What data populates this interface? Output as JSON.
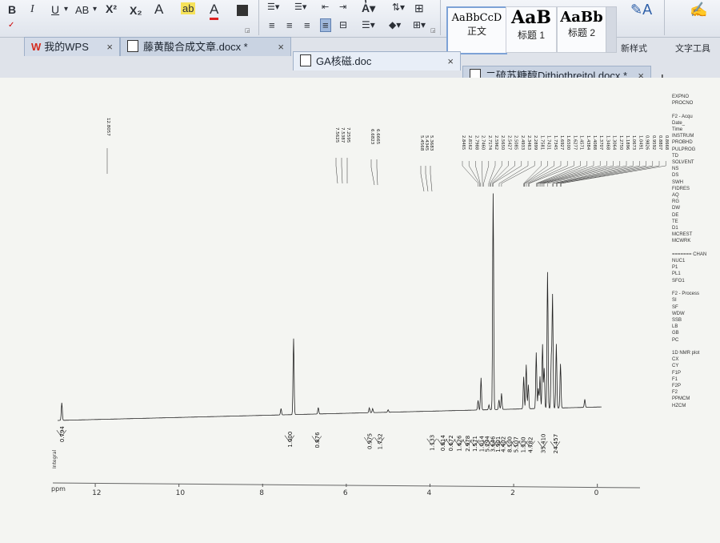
{
  "toolbar": {
    "bold": "B",
    "italic": "I",
    "underline": "U",
    "font_case": "AB",
    "superscript": "X²",
    "subscript": "X₂",
    "text_effect": "A",
    "highlight": "ab",
    "font_color": "A",
    "styles": [
      {
        "preview": "AaBbCcD",
        "name": "正文"
      },
      {
        "preview": "AaB",
        "name": "标题 1"
      },
      {
        "preview": "AaBb",
        "name": "标题 2"
      }
    ],
    "new_style": "新样式",
    "text_tools": "文字工具"
  },
  "tabs": [
    {
      "label": "我的WPS",
      "close": "×"
    },
    {
      "label": "藤黄酸合成文章.docx *",
      "close": "×"
    },
    {
      "label": "GA核磁.doc",
      "close": "×"
    },
    {
      "label": "二硫苏糖醇Dithiothreitol.docx *",
      "close": "×"
    }
  ],
  "new_tab": "+",
  "spectrum": {
    "ppm_axis_label": "ppm",
    "integral_label": "Integral",
    "axis_ticks": [
      "12",
      "10",
      "8",
      "6",
      "4",
      "2",
      "0"
    ],
    "peak_labels_group1": [
      "12.8057"
    ],
    "peak_labels_group2": [
      "7.5625",
      "7.5387",
      "7.2595"
    ],
    "peak_labels_group3": [
      "6.6823",
      "6.6665"
    ],
    "peak_labels_group4": [
      "5.4568",
      "5.4345",
      "5.3683"
    ],
    "peak_labels_group5": [
      "2.8465",
      "2.8162",
      "2.7988",
      "2.7460",
      "2.7174",
      "2.5962",
      "2.5650",
      "2.5427",
      "2.5085",
      "2.4933",
      "2.3463",
      "2.2899",
      "1.7581",
      "1.7431",
      "1.7345",
      "1.6927",
      "1.6500",
      "1.6277",
      "1.4571",
      "1.4384",
      "1.4088",
      "1.3707",
      "1.3468",
      "1.3064",
      "1.2750",
      "1.1896",
      "1.0673",
      "1.0491",
      "0.9826",
      "0.9592",
      "0.8807",
      "0.8668"
    ],
    "integrals": [
      "0.794",
      "1.000",
      "0.876",
      "0.975",
      "1.732",
      "1.133",
      "0.814",
      "0.672",
      "1.626",
      "2.978",
      "1.571",
      "1.014",
      "5.294",
      "3.646",
      "1.901",
      "4.402",
      "8.100",
      "5.107",
      "1.330",
      "4.782",
      "35.410",
      "24.457"
    ],
    "side_params": [
      "EXPNO",
      "PROCNO",
      "",
      "F2 - Acqu",
      "Date_",
      "Time",
      "INSTRUM",
      "PROBHD",
      "PULPROG",
      "TD",
      "SOLVENT",
      "NS",
      "DS",
      "SWH",
      "FIDRES",
      "AQ",
      "RG",
      "DW",
      "DE",
      "TE",
      "D1",
      "MCREST",
      "MCWRK",
      "",
      "======= CHAN",
      "NUC1",
      "P1",
      "PL1",
      "SFO1",
      "",
      "F2 - Process",
      "SI",
      "SF",
      "WDW",
      "SSB",
      "LB",
      "GB",
      "PC",
      "",
      "1D NMR plot",
      "CX",
      "CY",
      "F1P",
      "F1",
      "F2P",
      "F2",
      "PPMCM",
      "HZCM"
    ]
  }
}
